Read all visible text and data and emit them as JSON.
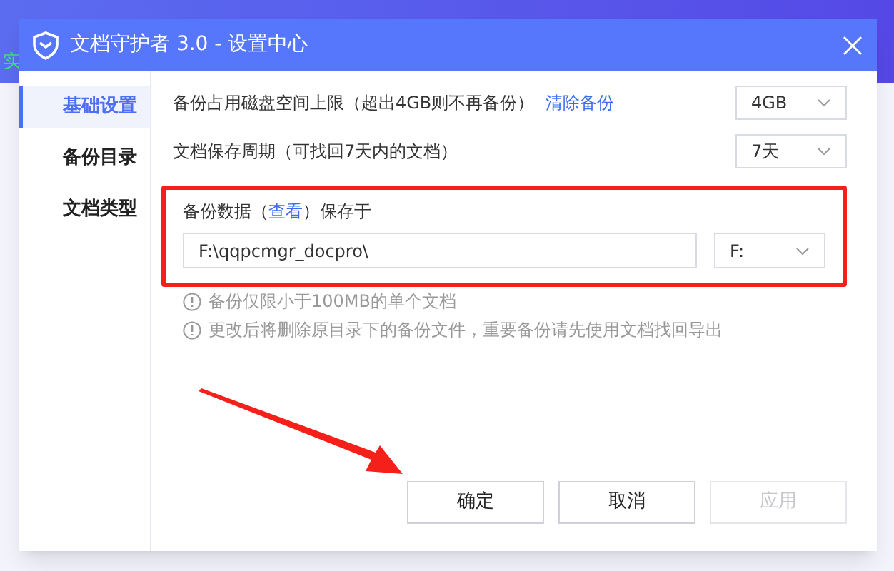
{
  "background_app": {
    "status_text": "实"
  },
  "window": {
    "title": "文档守护者 3.0 - 设置中心"
  },
  "sidebar": {
    "items": [
      {
        "label": "基础设置",
        "selected": true
      },
      {
        "label": "备份目录",
        "selected": false
      },
      {
        "label": "文档类型",
        "selected": false
      }
    ]
  },
  "settings": [
    {
      "label": "备份占用磁盘空间上限（超出4GB则不再备份）",
      "link": "清除备份",
      "value": "4GB"
    },
    {
      "label": "文档保存周期（可找回7天内的文档）",
      "value": "7天"
    }
  ],
  "backup_location": {
    "label_before": "备份数据（",
    "link": "查看",
    "label_after": "）保存于",
    "path": "F:\\qqpcmgr_docpro\\",
    "drive": "F:"
  },
  "hints": [
    "备份仅限小于100MB的单个文档",
    "更改后将删除原目录下的备份文件，重要备份请先使用文档找回导出"
  ],
  "buttons": [
    {
      "label": "确定",
      "disabled": false
    },
    {
      "label": "取消",
      "disabled": false
    },
    {
      "label": "应用",
      "disabled": true
    }
  ]
}
